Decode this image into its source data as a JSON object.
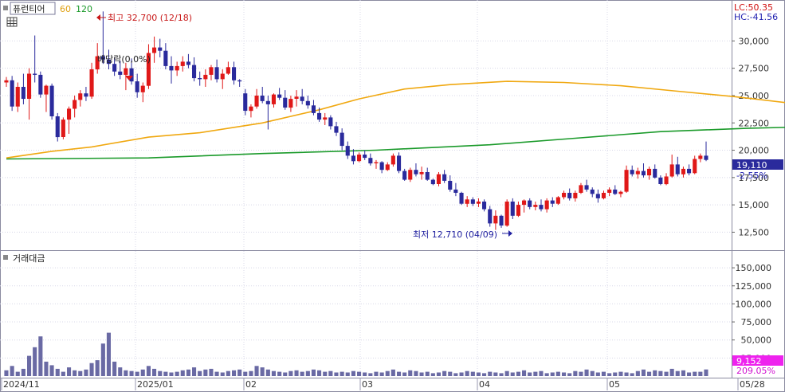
{
  "legend": {
    "name": "퓨런티어",
    "ma1_label": "60",
    "ma2_label": "120"
  },
  "toolbar": {
    "icon": "grid-icon"
  },
  "colors": {
    "up": "#e01818",
    "down": "#2a2a9c",
    "ma60": "#f0a810",
    "ma120": "#1a9a2a",
    "volume": "#6a6aa4",
    "grid": "#d8d8e8",
    "axis_text": "#333333",
    "price_label_bg": "#2a2a9c",
    "volume_label_bg": "#ee22ee",
    "annotation": "#c81818",
    "annotation_low": "#2020a0"
  },
  "corner": {
    "lc": "LC:50.35",
    "hc": "HC:-41.56"
  },
  "annotations": {
    "high": "최고 32,700 (12/18)",
    "low": "최저 12,710 (04/09)",
    "dividend": "배당락(0,0%)"
  },
  "current": {
    "price": "19,110",
    "change": "-2.55%"
  },
  "volume_panel": {
    "title": "거래대금",
    "current": "9,152",
    "ratio": "209.05%"
  },
  "chart_data": {
    "type": "candlestick",
    "price_axis": {
      "ticks": [
        "30,000",
        "27,500",
        "25,000",
        "22,500",
        "20,000",
        "17,500",
        "15,000",
        "12,500"
      ],
      "ylim": [
        11000,
        33600
      ]
    },
    "volume_axis": {
      "ticks": [
        "150,000",
        "125,000",
        "100,000",
        "75,000",
        "50,000",
        "25,000"
      ],
      "ylim": [
        0,
        170000
      ]
    },
    "x_labels": [
      "2024/11",
      "2025/01",
      "02",
      "03",
      "04",
      "05",
      "05/28"
    ],
    "candles": [
      [
        26200,
        26700,
        25800,
        26400
      ],
      [
        26400,
        26800,
        23600,
        24000
      ],
      [
        24000,
        26200,
        23500,
        25800
      ],
      [
        25800,
        27000,
        24200,
        24700
      ],
      [
        24700,
        27500,
        22800,
        27000
      ],
      [
        27000,
        30500,
        26200,
        26900
      ],
      [
        26900,
        27200,
        24800,
        25100
      ],
      [
        25100,
        26000,
        23500,
        25900
      ],
      [
        25900,
        26100,
        22800,
        23100
      ],
      [
        23100,
        23400,
        20800,
        21200
      ],
      [
        21200,
        23000,
        21000,
        22800
      ],
      [
        22800,
        24000,
        21500,
        23800
      ],
      [
        23800,
        25000,
        23000,
        24600
      ],
      [
        24600,
        25500,
        24000,
        25200
      ],
      [
        25200,
        25800,
        24500,
        24900
      ],
      [
        24900,
        28000,
        24700,
        27400
      ],
      [
        27400,
        29800,
        27000,
        28600
      ],
      [
        28600,
        32700,
        27900,
        28300
      ],
      [
        28300,
        29200,
        27400,
        27900
      ],
      [
        27900,
        28500,
        26800,
        27200
      ],
      [
        27200,
        28200,
        26500,
        26900
      ],
      [
        26900,
        28000,
        25500,
        27500
      ],
      [
        27500,
        28400,
        26000,
        26300
      ],
      [
        26300,
        27000,
        24800,
        25300
      ],
      [
        25300,
        26200,
        24400,
        25900
      ],
      [
        25900,
        29700,
        25600,
        28900
      ],
      [
        28900,
        30400,
        28000,
        29400
      ],
      [
        29400,
        30200,
        28500,
        29100
      ],
      [
        29100,
        29800,
        27400,
        27700
      ],
      [
        27700,
        28600,
        26100,
        27300
      ],
      [
        27300,
        28100,
        26800,
        27700
      ],
      [
        27700,
        28600,
        27200,
        28100
      ],
      [
        28100,
        28800,
        27500,
        27800
      ],
      [
        27800,
        28500,
        26300,
        26600
      ],
      [
        26600,
        27200,
        25900,
        26500
      ],
      [
        26500,
        27400,
        25800,
        26900
      ],
      [
        26900,
        27800,
        26400,
        27600
      ],
      [
        27600,
        28300,
        26200,
        26500
      ],
      [
        26500,
        27400,
        25600,
        27000
      ],
      [
        27000,
        28100,
        26900,
        27600
      ],
      [
        27600,
        28100,
        26000,
        26400
      ],
      [
        26400,
        26500,
        25800,
        26300
      ],
      [
        25200,
        25600,
        23200,
        23600
      ],
      [
        23600,
        24200,
        23000,
        24000
      ],
      [
        24000,
        25600,
        23800,
        25000
      ],
      [
        25000,
        25800,
        24300,
        24500
      ],
      [
        24500,
        25000,
        21900,
        24200
      ],
      [
        24200,
        25200,
        23900,
        25100
      ],
      [
        25100,
        25700,
        24600,
        24800
      ],
      [
        24800,
        25500,
        23700,
        23900
      ],
      [
        23900,
        25000,
        23500,
        24700
      ],
      [
        24700,
        25500,
        24000,
        24900
      ],
      [
        24900,
        25600,
        24200,
        24500
      ],
      [
        24500,
        25000,
        23800,
        24100
      ],
      [
        24100,
        24600,
        23200,
        23400
      ],
      [
        23400,
        23900,
        22600,
        22800
      ],
      [
        22800,
        23400,
        22300,
        23000
      ],
      [
        23000,
        23200,
        21900,
        22200
      ],
      [
        22200,
        22600,
        21300,
        21600
      ],
      [
        21600,
        22000,
        20000,
        20400
      ],
      [
        20400,
        20800,
        19200,
        19500
      ],
      [
        19500,
        20100,
        18700,
        19000
      ],
      [
        19000,
        19800,
        18900,
        19600
      ],
      [
        19600,
        20000,
        19100,
        19300
      ],
      [
        19300,
        19700,
        18600,
        18800
      ],
      [
        18800,
        19100,
        18300,
        18900
      ],
      [
        18900,
        19000,
        17900,
        18200
      ],
      [
        18200,
        18900,
        18100,
        18700
      ],
      [
        18700,
        19700,
        18500,
        19500
      ],
      [
        19500,
        19800,
        17900,
        18100
      ],
      [
        18100,
        18300,
        17200,
        17300
      ],
      [
        17300,
        18400,
        17100,
        18200
      ],
      [
        18200,
        18800,
        17600,
        17800
      ],
      [
        17800,
        18500,
        17300,
        18000
      ],
      [
        18000,
        18400,
        17200,
        17300
      ],
      [
        17300,
        17400,
        16800,
        16900
      ],
      [
        16900,
        18000,
        16700,
        17800
      ],
      [
        17800,
        18200,
        17000,
        17200
      ],
      [
        17200,
        17700,
        16200,
        16400
      ],
      [
        16400,
        17000,
        15800,
        16100
      ],
      [
        16100,
        16200,
        15000,
        15100
      ],
      [
        15100,
        15800,
        14800,
        15500
      ],
      [
        15500,
        15700,
        14900,
        15100
      ],
      [
        15100,
        15600,
        14800,
        15300
      ],
      [
        15300,
        15500,
        14400,
        14600
      ],
      [
        14600,
        14900,
        13000,
        13300
      ],
      [
        13300,
        14500,
        12710,
        14000
      ],
      [
        14000,
        14100,
        12900,
        13100
      ],
      [
        13100,
        15500,
        13000,
        15300
      ],
      [
        15300,
        15600,
        13700,
        14000
      ],
      [
        14000,
        15300,
        13900,
        15000
      ],
      [
        15000,
        15500,
        14300,
        15400
      ],
      [
        15400,
        15600,
        14600,
        14800
      ],
      [
        14800,
        15300,
        14500,
        15000
      ],
      [
        15000,
        15500,
        14400,
        14600
      ],
      [
        14600,
        15600,
        14300,
        15400
      ],
      [
        15400,
        15700,
        14800,
        15100
      ],
      [
        15100,
        15800,
        15000,
        15700
      ],
      [
        15700,
        16300,
        15500,
        16100
      ],
      [
        16100,
        16500,
        15400,
        15600
      ],
      [
        15600,
        16300,
        15300,
        16100
      ],
      [
        16100,
        17000,
        16000,
        16800
      ],
      [
        16800,
        17300,
        16200,
        16400
      ],
      [
        16400,
        16600,
        15700,
        16000
      ],
      [
        16000,
        16400,
        15200,
        15600
      ],
      [
        15600,
        16300,
        15500,
        16100
      ],
      [
        16100,
        16600,
        15800,
        16400
      ],
      [
        16400,
        16800,
        15900,
        16000
      ],
      [
        16000,
        16300,
        15700,
        16200
      ],
      [
        16200,
        18600,
        16100,
        18200
      ],
      [
        18200,
        18600,
        17600,
        17800
      ],
      [
        17800,
        18400,
        17400,
        18100
      ],
      [
        18100,
        18800,
        17500,
        17700
      ],
      [
        17700,
        18500,
        17300,
        18300
      ],
      [
        18300,
        18700,
        17400,
        17500
      ],
      [
        17500,
        17700,
        16800,
        16900
      ],
      [
        16900,
        17900,
        16800,
        17600
      ],
      [
        17600,
        19600,
        17500,
        18700
      ],
      [
        18700,
        19400,
        17600,
        17800
      ],
      [
        17800,
        18500,
        17500,
        18300
      ],
      [
        18300,
        18700,
        17700,
        17900
      ],
      [
        17900,
        19500,
        17800,
        19200
      ],
      [
        19200,
        19700,
        18900,
        19500
      ],
      [
        19500,
        20800,
        19000,
        19110
      ]
    ],
    "ma60": [
      [
        0,
        19300
      ],
      [
        8,
        19900
      ],
      [
        15,
        20300
      ],
      [
        25,
        21200
      ],
      [
        34,
        21600
      ],
      [
        45,
        22500
      ],
      [
        55,
        23700
      ],
      [
        62,
        24700
      ],
      [
        70,
        25600
      ],
      [
        78,
        26000
      ],
      [
        88,
        26300
      ],
      [
        98,
        26200
      ],
      [
        108,
        25900
      ],
      [
        118,
        25400
      ],
      [
        128,
        24900
      ],
      [
        138,
        24300
      ],
      [
        148,
        23600
      ],
      [
        158,
        22800
      ],
      [
        168,
        22000
      ],
      [
        178,
        21100
      ],
      [
        188,
        20200
      ],
      [
        198,
        19400
      ],
      [
        208,
        18700
      ],
      [
        218,
        18100
      ],
      [
        228,
        17500
      ],
      [
        238,
        17000
      ],
      [
        248,
        16700
      ],
      [
        256,
        16700
      ]
    ],
    "ma120": [
      [
        0,
        19200
      ],
      [
        25,
        19300
      ],
      [
        45,
        19700
      ],
      [
        65,
        20000
      ],
      [
        85,
        20500
      ],
      [
        100,
        21100
      ],
      [
        115,
        21700
      ],
      [
        130,
        22000
      ],
      [
        145,
        22200
      ],
      [
        160,
        22200
      ],
      [
        175,
        22000
      ],
      [
        185,
        21800
      ],
      [
        200,
        21700
      ],
      [
        220,
        21700
      ],
      [
        240,
        21600
      ],
      [
        256,
        21300
      ]
    ],
    "volume": [
      8000,
      14000,
      6000,
      10000,
      28000,
      40000,
      55000,
      20000,
      15000,
      10000,
      6000,
      12000,
      8000,
      7000,
      9000,
      18000,
      22000,
      45000,
      60000,
      20000,
      12000,
      8000,
      7000,
      6000,
      9000,
      14000,
      10000,
      7000,
      6000,
      5000,
      6000,
      8000,
      9000,
      12000,
      7000,
      9000,
      10000,
      6000,
      5000,
      7000,
      8000,
      9000,
      6000,
      7000,
      14000,
      12000,
      9000,
      7000,
      6000,
      5000,
      7000,
      8000,
      6000,
      7000,
      9000,
      8000,
      6000,
      7000,
      5000,
      6000,
      5000,
      7000,
      6000,
      5000,
      4000,
      6000,
      5000,
      7000,
      9000,
      6000,
      5000,
      8000,
      7000,
      5000,
      6000,
      4000,
      5000,
      7000,
      6000,
      4000,
      5000,
      7000,
      6000,
      5000,
      4000,
      6000,
      5000,
      4000,
      7000,
      5000,
      6000,
      8000,
      5000,
      6000,
      7000,
      4000,
      5000,
      6000,
      5000,
      4000,
      7000,
      6000,
      9000,
      7000,
      5000,
      6000,
      4000,
      5000,
      6000,
      5000,
      4000,
      7000,
      9000,
      6000,
      8000,
      7000,
      6000,
      10000,
      7000,
      8000,
      5000,
      6000,
      6000,
      9152
    ]
  }
}
